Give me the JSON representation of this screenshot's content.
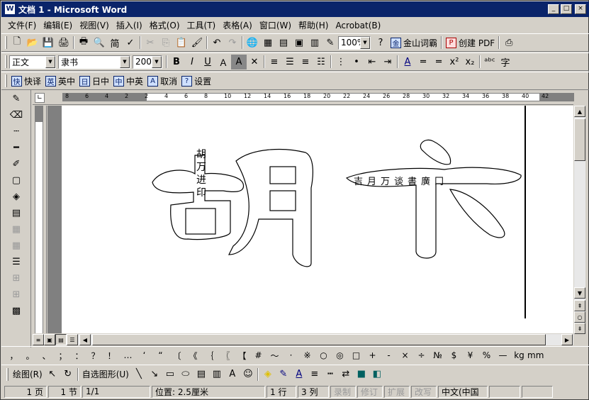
{
  "titlebar": {
    "title": "文档 1 - Microsoft Word",
    "app_icon": "word-doc-icon",
    "minimize": "_",
    "maximize": "□",
    "close": "×"
  },
  "menu": [
    "文件(F)",
    "编辑(E)",
    "视图(V)",
    "插入(I)",
    "格式(O)",
    "工具(T)",
    "表格(A)",
    "窗口(W)",
    "帮助(H)",
    "Acrobat(B)"
  ],
  "toolbar_standard": {
    "zoom": "100%",
    "jinshan": "金山词霸",
    "create_pdf": "创建 PDF"
  },
  "toolbar_format": {
    "style": "正文",
    "font": "隶书",
    "size": "200",
    "bold": "B",
    "italic": "I",
    "underline": "U"
  },
  "toolbar_translate": {
    "kuaiyi": "快译",
    "yingzhong": "英中",
    "rizhong": "日中",
    "zhongying": "中英",
    "quxiao": "取消",
    "shezhi": "设置"
  },
  "ruler": {
    "ticks": [
      "8",
      "6",
      "4",
      "2",
      "2",
      "4",
      "6",
      "8",
      "10",
      "12",
      "14",
      "16",
      "18",
      "20",
      "22",
      "24",
      "26",
      "28",
      "30",
      "32",
      "34",
      "36",
      "38",
      "40",
      "42"
    ]
  },
  "document": {
    "char1": "胡",
    "char2": "卞",
    "small_stack": [
      "胡",
      "万",
      "进",
      "印"
    ],
    "subscript_line": "吉月万谈書廣冂"
  },
  "symbols": [
    "，",
    "。",
    "、",
    "；",
    "：",
    "？",
    "！",
    "…",
    "‘",
    "“",
    "〔",
    "《",
    "｛",
    "〖",
    "【",
    "#",
    "～",
    "·",
    "※",
    "○",
    "◎",
    "□",
    "+",
    "-",
    "×",
    "÷",
    "№",
    "$",
    "¥",
    "%",
    "—",
    "kg",
    "mm"
  ],
  "drawbar": {
    "draw": "绘图(R)",
    "autoshapes": "自选图形(U)"
  },
  "status": {
    "page": "1 页",
    "section": "1 节",
    "pages": "1/1",
    "position": "位置: 2.5厘米",
    "line": "1 行",
    "col": "3 列",
    "rec": "录制",
    "trk": "修订",
    "ext": "扩展",
    "ovr": "改写",
    "lang": "中文(中国"
  }
}
